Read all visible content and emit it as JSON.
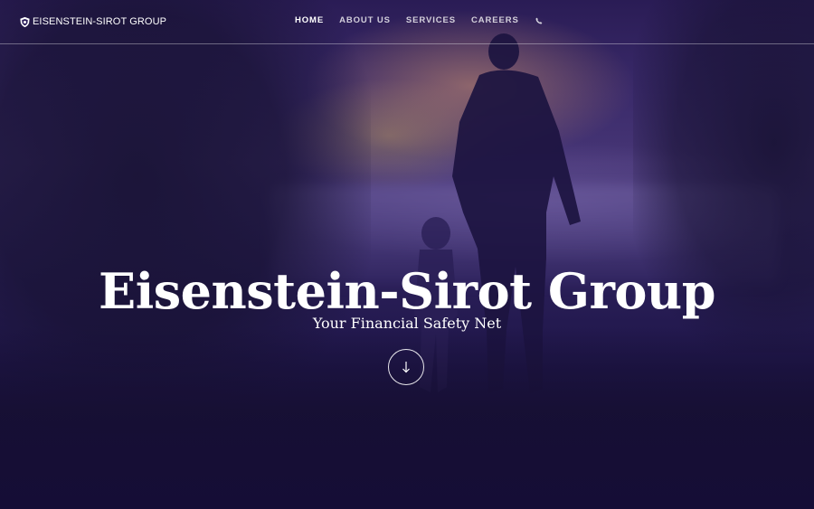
{
  "brand": {
    "logo_icon": "shield-icon",
    "name": "EISENSTEIN-SIROT GROUP"
  },
  "nav": {
    "items": [
      {
        "label": "HOME",
        "active": true
      },
      {
        "label": "ABOUT US",
        "active": false
      },
      {
        "label": "SERVICES",
        "active": false
      },
      {
        "label": "CAREERS",
        "active": false
      }
    ],
    "phone_icon": "phone-icon"
  },
  "hero": {
    "title": "Eisenstein-Sirot Group",
    "subtitle": "Your Financial Safety Net",
    "scroll_icon": "arrow-down-icon",
    "overlay_color": "#2a1c5a"
  }
}
